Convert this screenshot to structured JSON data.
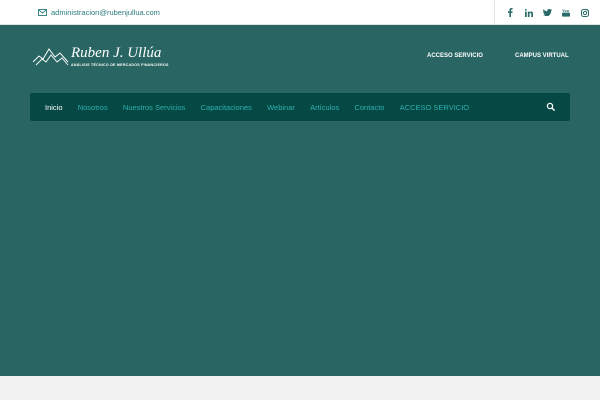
{
  "topbar": {
    "email": "administracion@rubenjullua.com",
    "email_icon": "envelope-icon",
    "social": [
      {
        "name": "facebook-icon",
        "glyph": "f"
      },
      {
        "name": "linkedin-icon",
        "glyph": "in"
      },
      {
        "name": "twitter-icon",
        "glyph": "t"
      },
      {
        "name": "youtube-icon",
        "glyph": "yt"
      },
      {
        "name": "instagram-icon",
        "glyph": "ig"
      }
    ]
  },
  "logo": {
    "name": "Ruben J. Ullúa",
    "tagline": "ANÁLISIS TÉCNICO DE MERCADOS FINANCIEROS",
    "icon": "mountains-icon"
  },
  "header_links": {
    "acceso": "ACCESO SERVICIO",
    "campus": "CAMPUS VIRTUAL"
  },
  "nav": {
    "items": [
      {
        "label": "Inicio",
        "active": true
      },
      {
        "label": "Nosotros",
        "active": false
      },
      {
        "label": "Nuestros Servicios",
        "active": false
      },
      {
        "label": "Capacitaciones",
        "active": false
      },
      {
        "label": "Webinar",
        "active": false
      },
      {
        "label": "Artículos",
        "active": false
      },
      {
        "label": "Contacto",
        "active": false
      },
      {
        "label": "ACCESO SERVICIO",
        "active": false
      }
    ],
    "search_icon": "search-icon"
  },
  "colors": {
    "header_bg": "#296663",
    "nav_bg": "#064844",
    "nav_link": "#2fb0ad",
    "nav_active": "#ffffff",
    "accent_text": "#2a7b7a"
  }
}
